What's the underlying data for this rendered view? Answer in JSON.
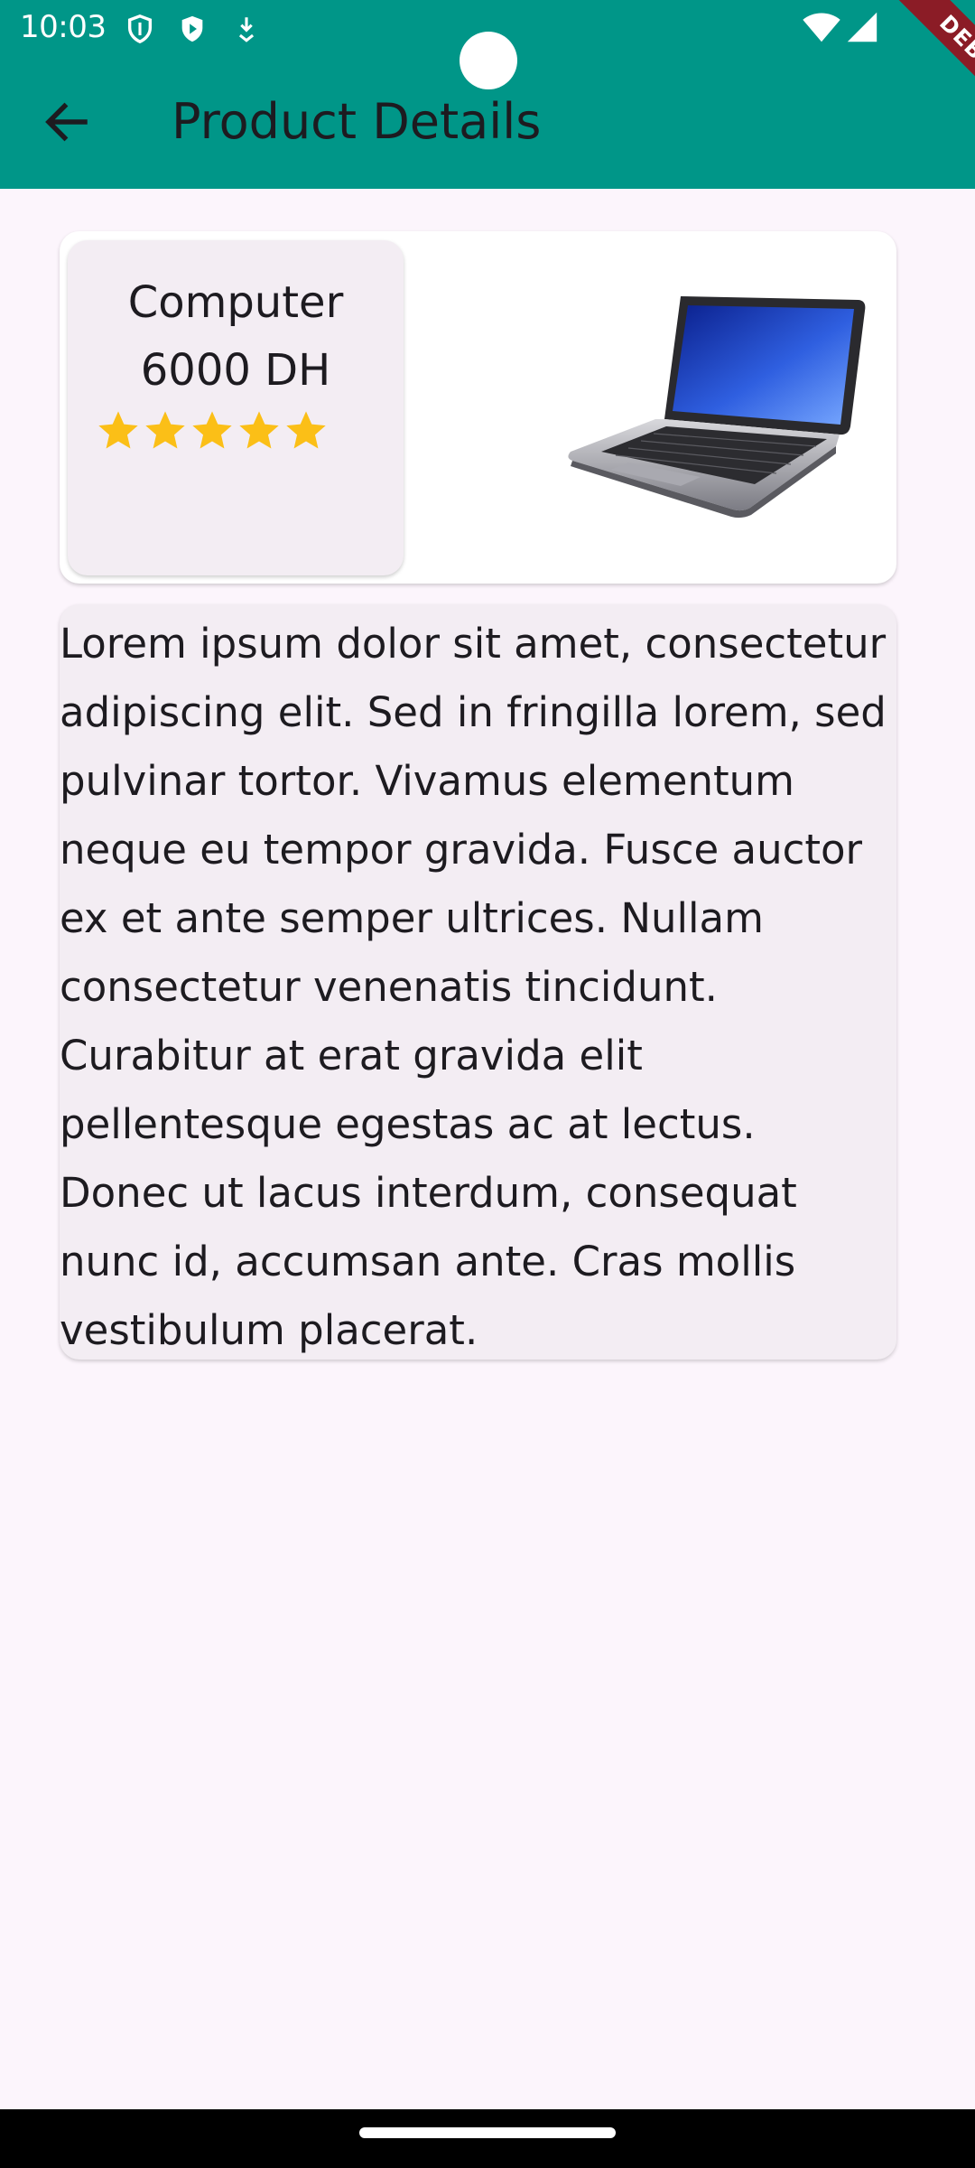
{
  "status_bar": {
    "time": "10:03",
    "icons": [
      "shield-icon",
      "play-protect-icon",
      "download-icon",
      "wifi-icon",
      "signal-icon"
    ]
  },
  "debug_banner": "DEBUG",
  "app_bar": {
    "title": "Product Details",
    "back_icon": "arrow-back-icon",
    "color": "#009688"
  },
  "product": {
    "name": "Computer",
    "price": "6000 DH",
    "rating": 5,
    "rating_max": 5,
    "star_color": "#fbbf17",
    "image": "laptop-image"
  },
  "description": "Lorem ipsum dolor sit amet, consectetur adipiscing elit. Sed in fringilla lorem, sed pulvinar tortor. Vivamus elementum neque eu tempor gravida. Fusce auctor ex et ante semper ultrices. Nullam consectetur venenatis tincidunt. Curabitur at erat gravida elit pellentesque egestas ac at lectus. Donec ut lacus interdum, consequat nunc id, accumsan ante. Cras mollis vestibulum placerat."
}
